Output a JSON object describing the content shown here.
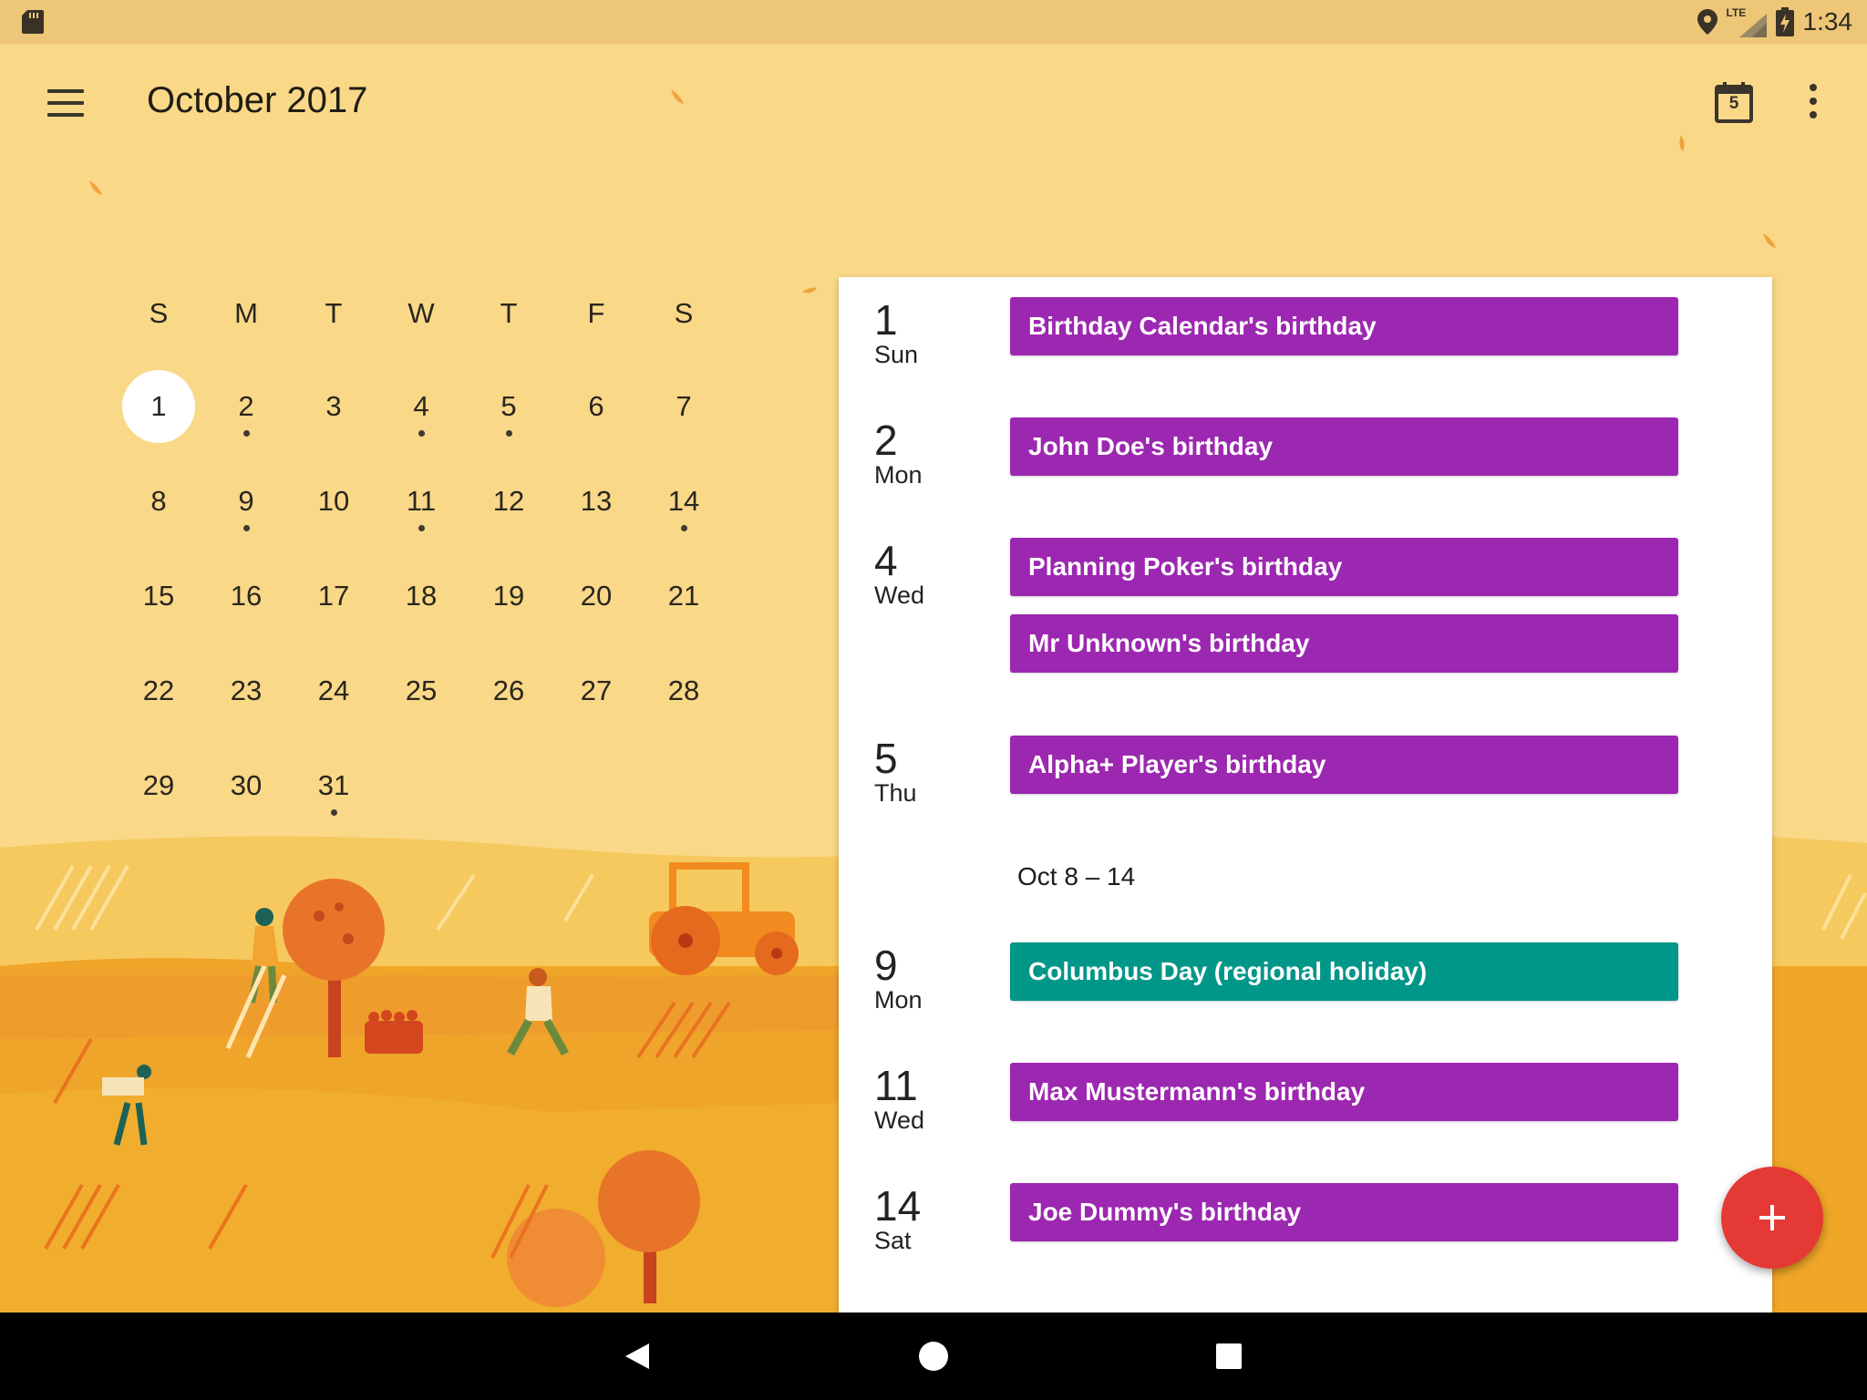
{
  "status_bar": {
    "time": "1:34",
    "network": "LTE",
    "icons": [
      "sd-card-icon",
      "location-icon",
      "signal-icon",
      "battery-charging-icon"
    ]
  },
  "toolbar": {
    "title": "October 2017",
    "today_date": "5",
    "icons": [
      "menu-icon",
      "calendar-today-icon",
      "more-vert-icon"
    ]
  },
  "mini_calendar": {
    "weekdays": [
      "S",
      "M",
      "T",
      "W",
      "T",
      "F",
      "S"
    ],
    "weeks": [
      [
        "1",
        "2",
        "3",
        "4",
        "5",
        "6",
        "7"
      ],
      [
        "8",
        "9",
        "10",
        "11",
        "12",
        "13",
        "14"
      ],
      [
        "15",
        "16",
        "17",
        "18",
        "19",
        "20",
        "21"
      ],
      [
        "22",
        "23",
        "24",
        "25",
        "26",
        "27",
        "28"
      ],
      [
        "29",
        "30",
        "31"
      ]
    ],
    "selected_day": "1",
    "days_with_events": [
      "2",
      "4",
      "5",
      "9",
      "11",
      "14",
      "31"
    ]
  },
  "schedule": {
    "days": [
      {
        "num": "1",
        "dow": "Sun",
        "events": [
          {
            "title": "Birthday Calendar's birthday",
            "kind": "birthday"
          }
        ]
      },
      {
        "num": "2",
        "dow": "Mon",
        "events": [
          {
            "title": "John Doe's birthday",
            "kind": "birthday"
          }
        ]
      },
      {
        "num": "4",
        "dow": "Wed",
        "events": [
          {
            "title": "Planning Poker's birthday",
            "kind": "birthday"
          },
          {
            "title": "Mr Unknown's birthday",
            "kind": "birthday"
          }
        ]
      },
      {
        "num": "5",
        "dow": "Thu",
        "events": [
          {
            "title": "Alpha+ Player's birthday",
            "kind": "birthday"
          }
        ]
      },
      {
        "num": "9",
        "dow": "Mon",
        "events": [
          {
            "title": "Columbus Day (regional holiday)",
            "kind": "holiday"
          }
        ]
      },
      {
        "num": "11",
        "dow": "Wed",
        "events": [
          {
            "title": "Max Mustermann's birthday",
            "kind": "birthday"
          }
        ]
      },
      {
        "num": "14",
        "dow": "Sat",
        "events": [
          {
            "title": "Joe Dummy's birthday",
            "kind": "birthday"
          }
        ]
      }
    ],
    "week_header": "Oct 8 – 14"
  },
  "fab": {
    "icon": "add-icon"
  },
  "nav_bar": {
    "icons": [
      "back-icon",
      "home-icon",
      "recents-icon"
    ]
  },
  "colors": {
    "background": "#f9d888",
    "status_bar": "#eec678",
    "birthday_event": "#9c27b0",
    "holiday_event": "#009688",
    "fab": "#e53935",
    "nav_bar": "#000000"
  }
}
